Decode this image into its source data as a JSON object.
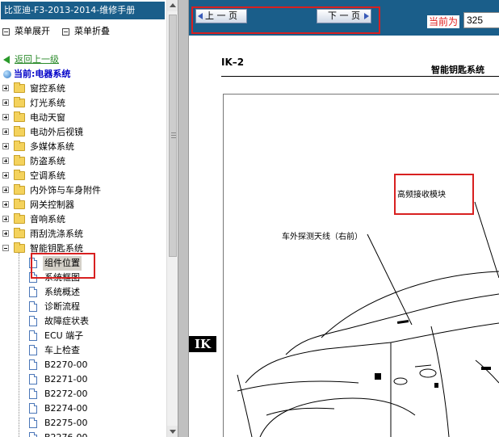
{
  "left": {
    "title": "比亚迪-F3-2013-2014-维修手册",
    "expand_label": "菜单展开",
    "collapse_label": "菜单折叠",
    "back_label": "返回上一级",
    "current_label": "当前:电器系统",
    "folders": [
      "窗控系统",
      "灯光系统",
      "电动天窗",
      "电动外后视镜",
      "多媒体系统",
      "防盗系统",
      "空调系统",
      "内外饰与车身附件",
      "网关控制器",
      "音响系统",
      "雨刮洗涤系统",
      "智能钥匙系统"
    ],
    "docs": [
      "组件位置",
      "系统框图",
      "系统概述",
      "诊断流程",
      "故障症状表",
      "ECU 端子",
      "车上检查",
      "B2270-00",
      "B2271-00",
      "B2272-00",
      "B2274-00",
      "B2275-00",
      "B2276-00"
    ]
  },
  "toolbar": {
    "prev_label": "上 一 页",
    "next_label": "下 一 页",
    "current_page_label": "当前为",
    "current_page_value": "325"
  },
  "document": {
    "page_number": "IK–2",
    "section_title": "智能钥匙系统",
    "label_hf_module": "高频接收模块",
    "label_antenna": "车外探测天线（右前）",
    "side_tab": "IK"
  }
}
